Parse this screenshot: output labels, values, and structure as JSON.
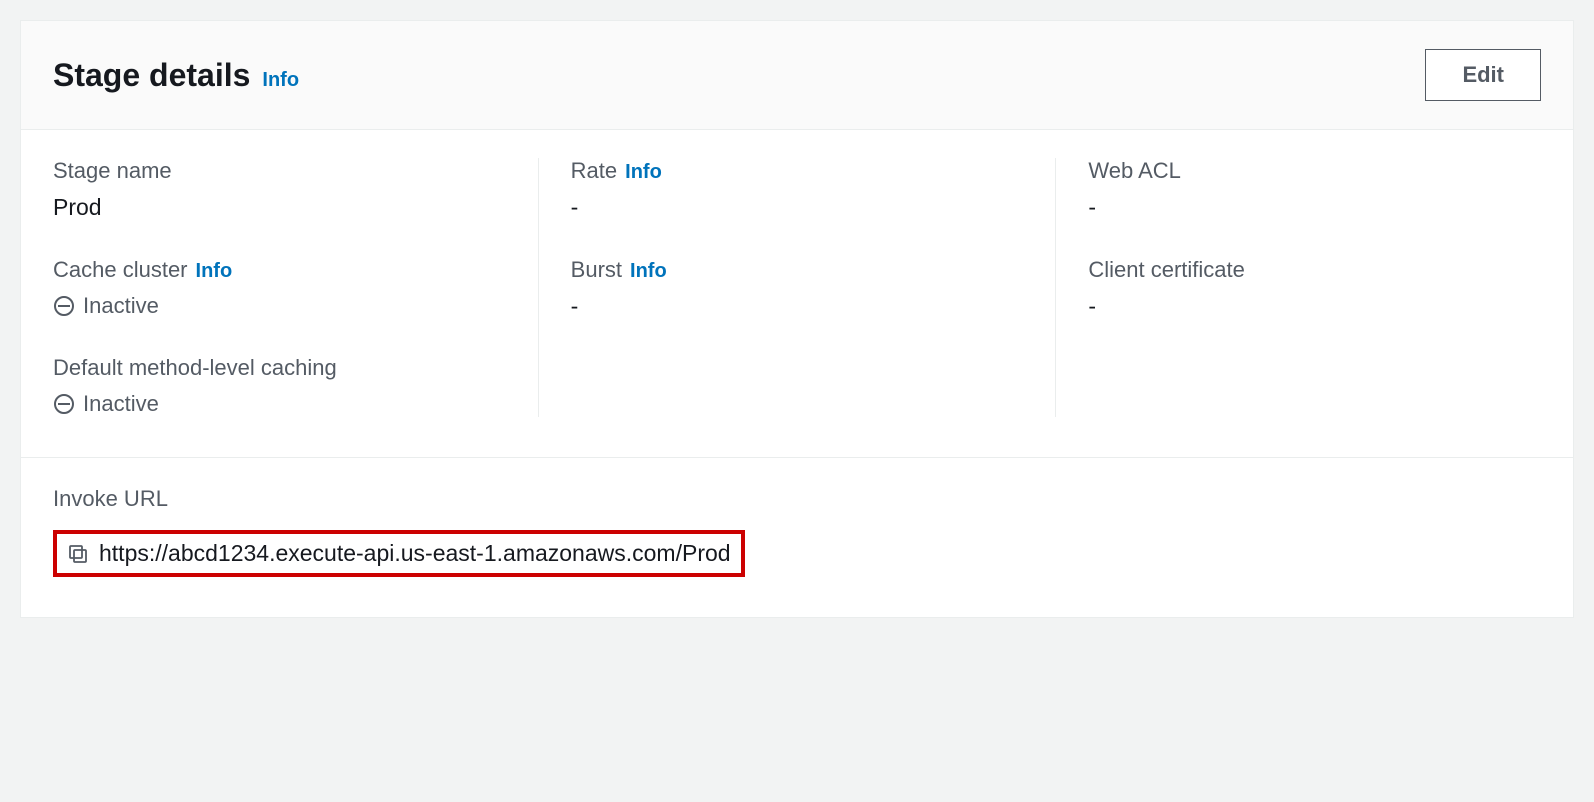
{
  "header": {
    "title": "Stage details",
    "info_label": "Info",
    "edit_label": "Edit"
  },
  "column1": {
    "stage_name_label": "Stage name",
    "stage_name_value": "Prod",
    "cache_cluster_label": "Cache cluster",
    "cache_cluster_info": "Info",
    "cache_cluster_status": "Inactive",
    "method_caching_label": "Default method-level caching",
    "method_caching_status": "Inactive"
  },
  "column2": {
    "rate_label": "Rate",
    "rate_info": "Info",
    "rate_value": "-",
    "burst_label": "Burst",
    "burst_info": "Info",
    "burst_value": "-"
  },
  "column3": {
    "web_acl_label": "Web ACL",
    "web_acl_value": "-",
    "client_cert_label": "Client certificate",
    "client_cert_value": "-"
  },
  "invoke": {
    "label": "Invoke URL",
    "url": "https://abcd1234.execute-api.us-east-1.amazonaws.com/Prod"
  }
}
